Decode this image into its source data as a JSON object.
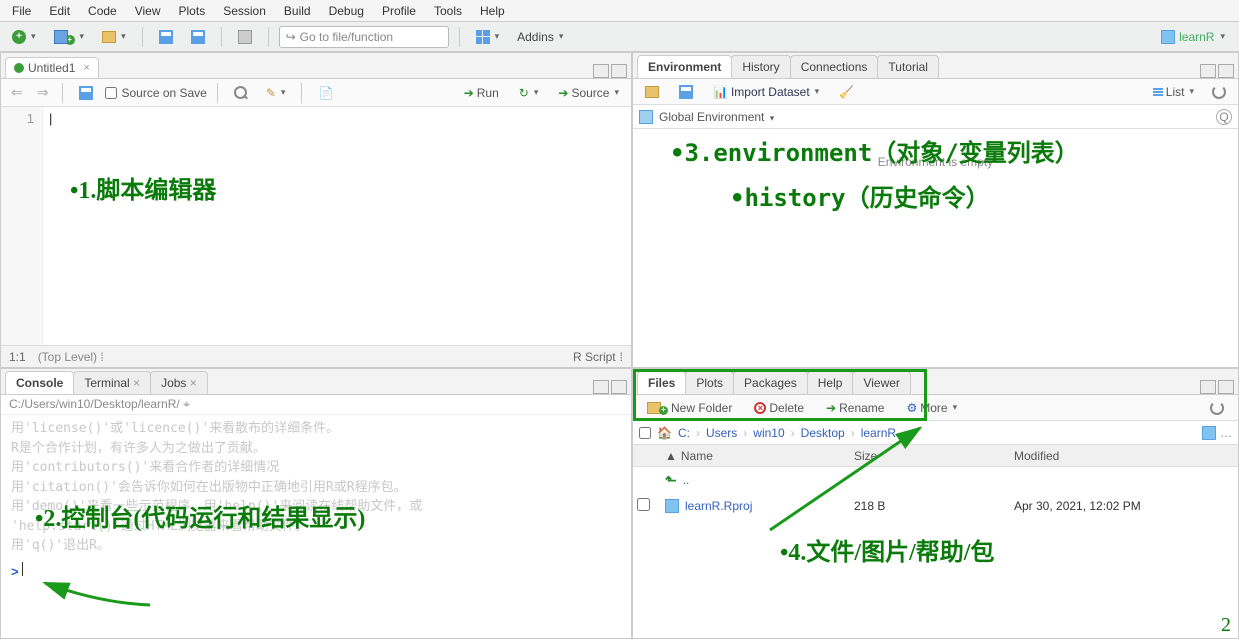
{
  "menubar": [
    "File",
    "Edit",
    "Code",
    "View",
    "Plots",
    "Session",
    "Build",
    "Debug",
    "Profile",
    "Tools",
    "Help"
  ],
  "main_toolbar": {
    "goto_placeholder": "Go to file/function",
    "addins": "Addins",
    "project_name": "learnR"
  },
  "source": {
    "tab_title": "Untitled1",
    "source_on_save": "Source on Save",
    "run": "Run",
    "source_btn": "Source",
    "line_no": "1",
    "status_pos": "1:1",
    "status_scope": "(Top Level)",
    "status_lang": "R Script"
  },
  "env": {
    "tabs": [
      "Environment",
      "History",
      "Connections",
      "Tutorial"
    ],
    "import": "Import Dataset",
    "list": "List",
    "scope": "Global Environment",
    "empty_msg": "Environment is empty"
  },
  "console": {
    "tabs": [
      "Console",
      "Terminal",
      "Jobs"
    ],
    "path": "C:/Users/win10/Desktop/learnR/",
    "lines": [
      "用'license()'或'licence()'来看散布的详细条件。",
      "",
      "R是个合作计划，有许多人为之做出了贡献。",
      "用'contributors()'来看合作者的详细情况",
      "用'citation()'会告诉你如何在出版物中正确地引用R或R程序包。",
      "",
      "用'demo()'来看一些示范程序，用'help()'来阅读在线帮助文件，或",
      "'help.start()'通过HTML浏览器来看帮助文件。",
      "用'q()'退出R。"
    ],
    "prompt": ">"
  },
  "files": {
    "tabs": [
      "Files",
      "Plots",
      "Packages",
      "Help",
      "Viewer"
    ],
    "new_folder": "New Folder",
    "delete": "Delete",
    "rename": "Rename",
    "more": "More",
    "breadcrumb": [
      "C:",
      "Users",
      "win10",
      "Desktop",
      "learnR"
    ],
    "col_name": "Name",
    "col_size": "Size",
    "col_modified": "Modified",
    "updir": "..",
    "rows": [
      {
        "name": "learnR.Rproj",
        "size": "218 B",
        "modified": "Apr 30, 2021, 12:02 PM"
      }
    ]
  },
  "annotations": {
    "a1": "•1.脚本编辑器",
    "a2": "•2.控制台(代码运行和结果显示)",
    "a3": "•3.environment（对象/变量列表）",
    "a3b": "•history（历史命令）",
    "a4": "•4.文件/图片/帮助/包",
    "page": "2"
  }
}
